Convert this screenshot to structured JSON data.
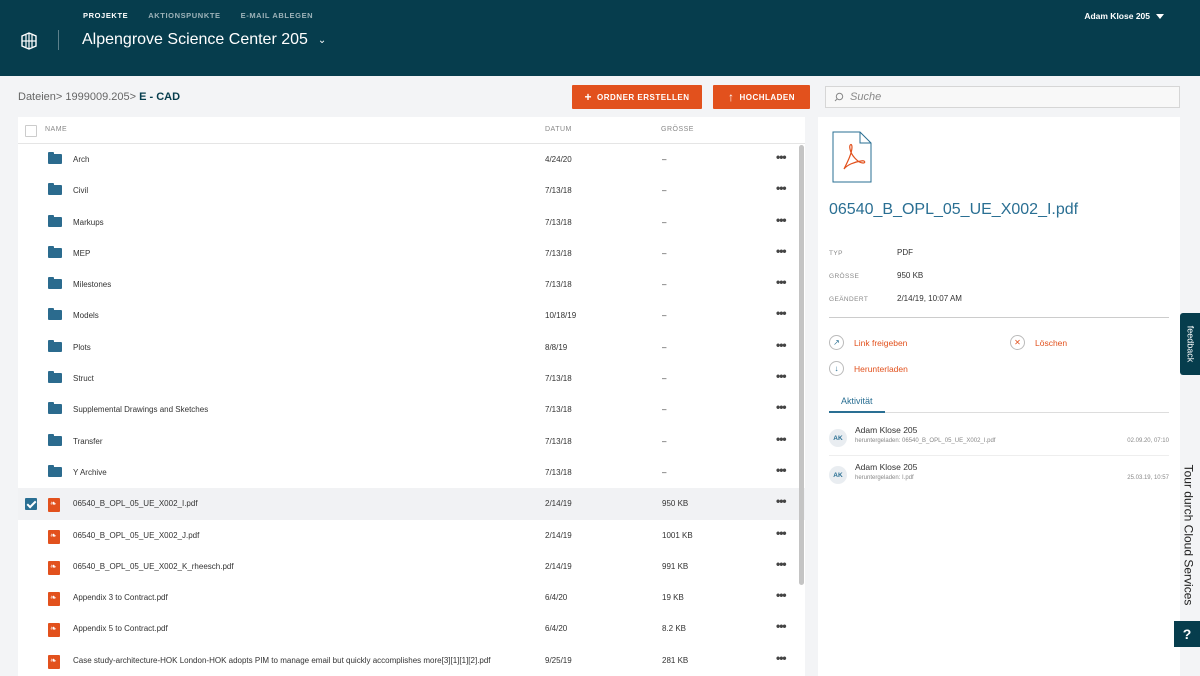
{
  "header": {
    "nav": [
      "PROJEKTE",
      "AKTIONSPUNKTE",
      "E-MAIL ABLEGEN"
    ],
    "project_title": "Alpengrove Science Center 205",
    "user": "Adam Klose 205"
  },
  "toolbar": {
    "breadcrumb_prefix": "Dateien> 1999009.205>",
    "breadcrumb_current": " E - CAD",
    "create_folder_label": "ORDNER ERSTELLEN",
    "upload_label": "HOCHLADEN",
    "search_placeholder": "Suche"
  },
  "file_list": {
    "columns": {
      "name": "NAME",
      "date": "DATUM",
      "size": "GRÖSSE"
    },
    "rows": [
      {
        "type": "folder",
        "name": "Arch",
        "date": "4/24/20",
        "size": "–"
      },
      {
        "type": "folder",
        "name": "Civil",
        "date": "7/13/18",
        "size": "–"
      },
      {
        "type": "folder",
        "name": "Markups",
        "date": "7/13/18",
        "size": "–"
      },
      {
        "type": "folder",
        "name": "MEP",
        "date": "7/13/18",
        "size": "–"
      },
      {
        "type": "folder",
        "name": "Milestones",
        "date": "7/13/18",
        "size": "–"
      },
      {
        "type": "folder",
        "name": "Models",
        "date": "10/18/19",
        "size": "–"
      },
      {
        "type": "folder",
        "name": "Plots",
        "date": "8/8/19",
        "size": "–"
      },
      {
        "type": "folder",
        "name": "Struct",
        "date": "7/13/18",
        "size": "–"
      },
      {
        "type": "folder",
        "name": "Supplemental Drawings and Sketches",
        "date": "7/13/18",
        "size": "–"
      },
      {
        "type": "folder",
        "name": "Transfer",
        "date": "7/13/18",
        "size": "–"
      },
      {
        "type": "folder",
        "name": "Y Archive",
        "date": "7/13/18",
        "size": "–"
      },
      {
        "type": "pdf",
        "name": "06540_B_OPL_05_UE_X002_I.pdf",
        "date": "2/14/19",
        "size": "950 KB",
        "selected": true
      },
      {
        "type": "pdf",
        "name": "06540_B_OPL_05_UE_X002_J.pdf",
        "date": "2/14/19",
        "size": "1001 KB"
      },
      {
        "type": "pdf",
        "name": "06540_B_OPL_05_UE_X002_K_rheesch.pdf",
        "date": "2/14/19",
        "size": "991 KB"
      },
      {
        "type": "pdf",
        "name": "Appendix 3 to Contract.pdf",
        "date": "6/4/20",
        "size": "19 KB"
      },
      {
        "type": "pdf",
        "name": "Appendix 5 to Contract.pdf",
        "date": "6/4/20",
        "size": "8.2 KB"
      },
      {
        "type": "pdf",
        "name": "Case study-architecture-HOK London-HOK adopts PIM to manage email but quickly accomplishes more[3][1][1][2].pdf",
        "date": "9/25/19",
        "size": "281 KB"
      }
    ]
  },
  "detail": {
    "file_name": "06540_B_OPL_05_UE_X002_I.pdf",
    "type_label": "TYP",
    "type_value": "PDF",
    "size_label": "GRÖSSE",
    "size_value": "950 KB",
    "modified_label": "GEÄNDERT",
    "modified_value": "2/14/19, 10:07 AM",
    "share_label": "Link freigeben",
    "delete_label": "Löschen",
    "download_label": "Herunterladen",
    "activity_tab": "Aktivität",
    "activity": [
      {
        "initials": "AK",
        "user": "Adam Klose 205",
        "desc": "heruntergeladen: 06540_B_OPL_05_UE_X002_I.pdf",
        "time": "02.09.20, 07:10"
      },
      {
        "initials": "AK",
        "user": "Adam Klose 205",
        "desc": "heruntergeladen: I.pdf",
        "time": "25.03.19, 10:57"
      }
    ]
  },
  "side": {
    "feedback": "feedback",
    "tour": "Tour durch Cloud Services",
    "help": "?"
  },
  "colors": {
    "header": "#063d4d",
    "accent": "#e2511d",
    "link": "#2a6f93"
  }
}
